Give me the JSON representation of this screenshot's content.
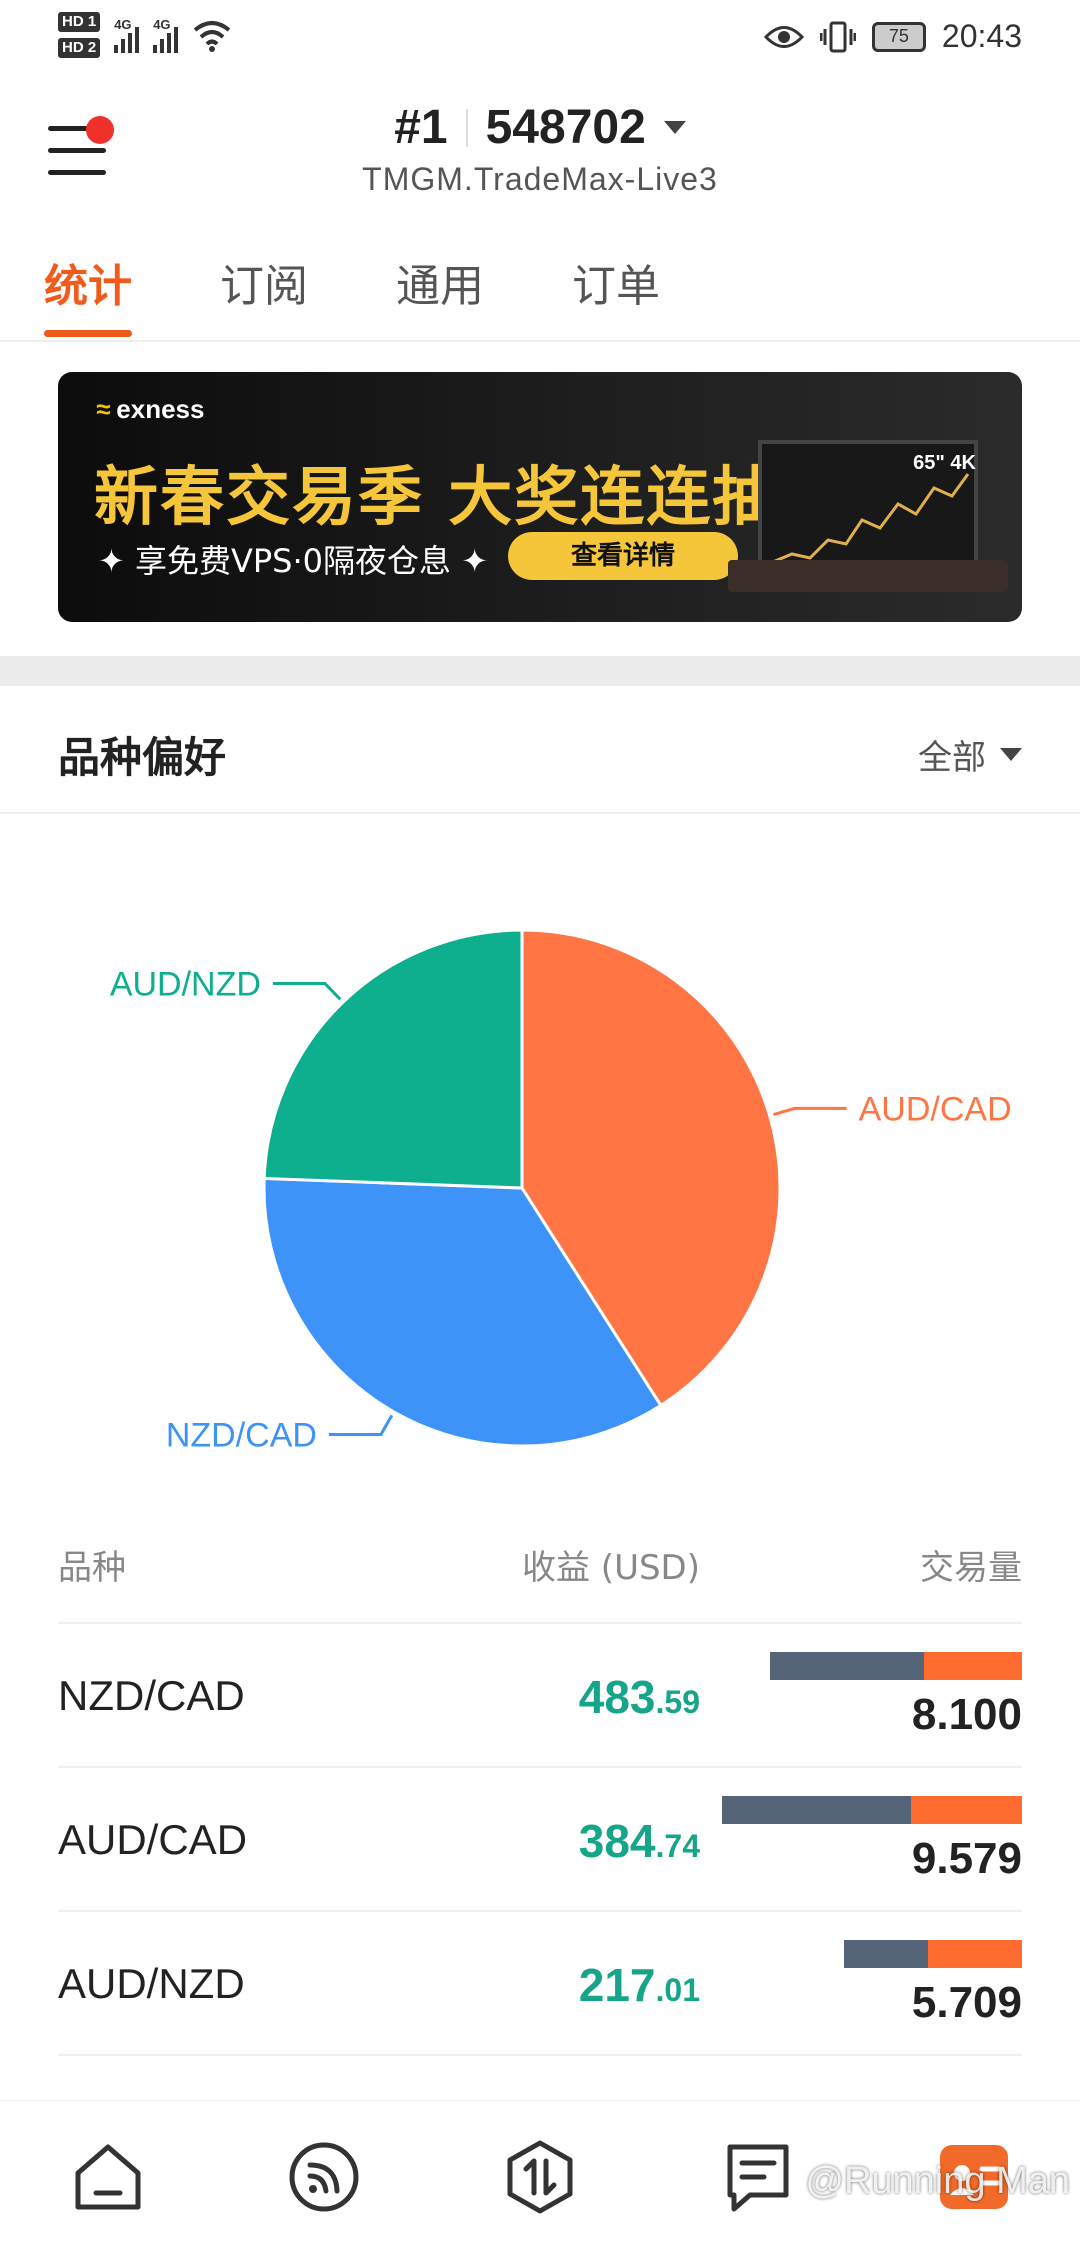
{
  "status_bar": {
    "hd1": "HD 1",
    "hd2": "HD 2",
    "net1": "4G",
    "net2": "4G",
    "battery": "75",
    "time": "20:43"
  },
  "header": {
    "account_prefix": "#1",
    "account_number": "548702",
    "server": "TMGM.TradeMax-Live3"
  },
  "tabs": [
    {
      "label": "统计",
      "active": true
    },
    {
      "label": "订阅",
      "active": false
    },
    {
      "label": "通用",
      "active": false
    },
    {
      "label": "订单",
      "active": false
    }
  ],
  "banner": {
    "brand": "exness",
    "headline": "新春交易季 大奖连连抽",
    "subline": "✦ 享免费VPS·0隔夜仓息 ✦",
    "cta": "查看详情",
    "tv_label": "65\" 4K"
  },
  "section": {
    "title": "品种偏好",
    "filter": "全部"
  },
  "chart_data": {
    "type": "pie",
    "slices": [
      {
        "label": "AUD/CAD",
        "value": 9.579,
        "color": "#ff7543"
      },
      {
        "label": "NZD/CAD",
        "value": 8.1,
        "color": "#3d93f8"
      },
      {
        "label": "AUD/NZD",
        "value": 5.709,
        "color": "#0daf8e"
      }
    ]
  },
  "table": {
    "headers": {
      "symbol": "品种",
      "profit": "收益 (USD)",
      "volume": "交易量"
    },
    "rows": [
      {
        "symbol": "NZD/CAD",
        "profit_int": "483",
        "profit_dec": ".59",
        "volume": "8.100",
        "buy_share": 0.61
      },
      {
        "symbol": "AUD/CAD",
        "profit_int": "384",
        "profit_dec": ".74",
        "volume": "9.579",
        "buy_share": 0.63
      },
      {
        "symbol": "AUD/NZD",
        "profit_int": "217",
        "profit_dec": ".01",
        "volume": "5.709",
        "buy_share": 0.47
      }
    ]
  },
  "bottom_nav": {
    "icons": [
      "home-icon",
      "signal-icon",
      "trade-icon",
      "news-icon",
      "profile-icon"
    ]
  },
  "watermark": "@Running Man",
  "colors": {
    "accent": "#f05a1a",
    "profit": "#17a58a",
    "bar_buy": "#556479",
    "bar_sell": "#ff6a2f"
  }
}
